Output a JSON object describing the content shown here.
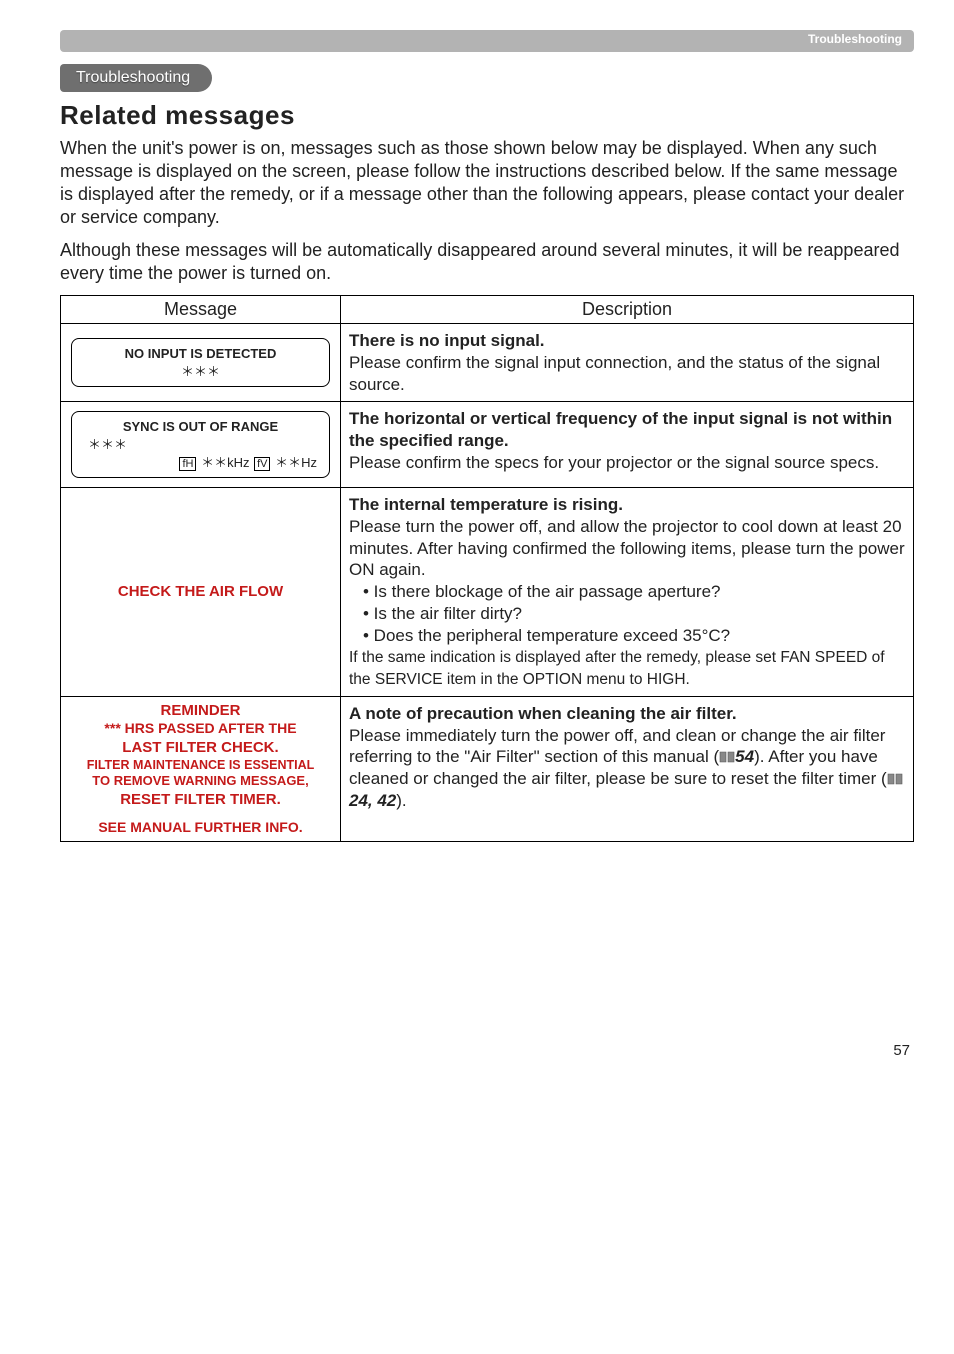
{
  "header": {
    "section": "Troubleshooting",
    "pill": "Troubleshooting"
  },
  "title": "Related messages",
  "intro1": "When the unit's power is on, messages such as those shown below may be displayed. When any such message is displayed on the screen, please follow the instructions described below. If the same message is displayed after the remedy, or if a message other than the following appears, please contact your dealer or service company.",
  "intro2": "Although these messages will be automatically disappeared around several minutes, it will be reappeared every time the power is turned on.",
  "table": {
    "headers": {
      "msg": "Message",
      "desc": "Description"
    },
    "rows": [
      {
        "msg": {
          "line1": "NO INPUT IS DETECTED",
          "line2": "＊＊＊"
        },
        "desc": {
          "bold": "There is no input signal.",
          "body": "Please confirm the signal input connection, and the status of the signal source."
        }
      },
      {
        "msg": {
          "line1": "SYNC IS OUT OF RANGE",
          "line2": "＊＊＊",
          "fh_label": "fH",
          "fh_val": "＊＊kHz",
          "fv_label": "fV",
          "fv_val": "＊＊Hz"
        },
        "desc": {
          "bold": "The horizontal or vertical frequency of the input signal is not within the specified range.",
          "body": "Please confirm the specs for your projector or the signal source specs."
        }
      },
      {
        "msg": {
          "line1": "CHECK THE AIR FLOW"
        },
        "desc": {
          "bold": "The internal temperature is rising.",
          "l1": "Please turn the power off, and allow the projector to cool down at least 20 minutes. After having confirmed the following items, please turn the power ON again.",
          "b1": "• Is there blockage of the air passage aperture?",
          "b2": "• Is the air filter dirty?",
          "b3": "• Does the peripheral temperature exceed 35°C?",
          "l2": "If the same indication is displayed after the remedy, please set FAN SPEED of the SERVICE item in the OPTION menu to HIGH."
        }
      },
      {
        "msg": {
          "l1": "REMINDER",
          "l2": "*** HRS PASSED AFTER THE",
          "l3": "LAST FILTER CHECK.",
          "l4": "FILTER MAINTENANCE IS ESSENTIAL",
          "l5": "TO REMOVE WARNING MESSAGE,",
          "l6": "RESET FILTER TIMER.",
          "l7": "SEE MANUAL FURTHER INFO."
        },
        "desc": {
          "bold": "A note of precaution when cleaning the air filter.",
          "l1": "Please immediately turn the power off, and clean or change the air filter referring to the \"Air Filter\" section of this manual (",
          "ref1": "54",
          "l2": "). After you have cleaned or changed the air filter, please be sure to reset the filter timer (",
          "ref2": "24, 42",
          "l3": ")."
        }
      }
    ]
  },
  "page": "57"
}
